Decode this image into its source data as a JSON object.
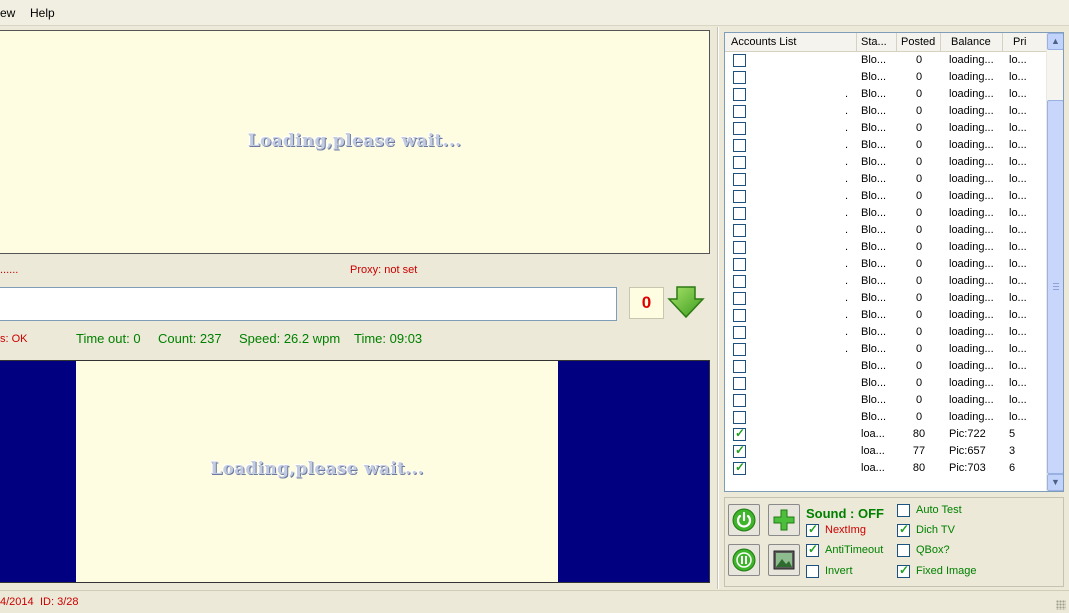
{
  "menu": {
    "items": [
      "ew",
      "Help"
    ]
  },
  "captcha_top": {
    "loading_text": "Loading,please wait..."
  },
  "status_line": {
    "left_text": "......",
    "proxy_text": "Proxy: not set"
  },
  "counter": {
    "value": "0"
  },
  "stats": {
    "status_text": "s: OK",
    "timeout": "Time out: 0",
    "count": "Count: 237",
    "speed": "Speed: 26.2 wpm",
    "time": "Time: 09:03"
  },
  "captcha_bottom": {
    "loading_text": "Loading,please wait..."
  },
  "statusbar": {
    "date_text": "4/2014",
    "id_text": "ID: 3/28"
  },
  "accounts": {
    "columns": [
      "Accounts List",
      "Sta...",
      "Posted",
      "Balance",
      "Pri"
    ],
    "rows": [
      {
        "checked": false,
        "dot": "",
        "status": "Blo...",
        "posted": "0",
        "balance": "loading...",
        "pri": "lo..."
      },
      {
        "checked": false,
        "dot": "",
        "status": "Blo...",
        "posted": "0",
        "balance": "loading...",
        "pri": "lo..."
      },
      {
        "checked": false,
        "dot": ".",
        "status": "Blo...",
        "posted": "0",
        "balance": "loading...",
        "pri": "lo..."
      },
      {
        "checked": false,
        "dot": ".",
        "status": "Blo...",
        "posted": "0",
        "balance": "loading...",
        "pri": "lo..."
      },
      {
        "checked": false,
        "dot": ".",
        "status": "Blo...",
        "posted": "0",
        "balance": "loading...",
        "pri": "lo..."
      },
      {
        "checked": false,
        "dot": ".",
        "status": "Blo...",
        "posted": "0",
        "balance": "loading...",
        "pri": "lo..."
      },
      {
        "checked": false,
        "dot": ".",
        "status": "Blo...",
        "posted": "0",
        "balance": "loading...",
        "pri": "lo..."
      },
      {
        "checked": false,
        "dot": ".",
        "status": "Blo...",
        "posted": "0",
        "balance": "loading...",
        "pri": "lo..."
      },
      {
        "checked": false,
        "dot": ".",
        "status": "Blo...",
        "posted": "0",
        "balance": "loading...",
        "pri": "lo..."
      },
      {
        "checked": false,
        "dot": ".",
        "status": "Blo...",
        "posted": "0",
        "balance": "loading...",
        "pri": "lo..."
      },
      {
        "checked": false,
        "dot": ".",
        "status": "Blo...",
        "posted": "0",
        "balance": "loading...",
        "pri": "lo..."
      },
      {
        "checked": false,
        "dot": ".",
        "status": "Blo...",
        "posted": "0",
        "balance": "loading...",
        "pri": "lo..."
      },
      {
        "checked": false,
        "dot": ".",
        "status": "Blo...",
        "posted": "0",
        "balance": "loading...",
        "pri": "lo..."
      },
      {
        "checked": false,
        "dot": ".",
        "status": "Blo...",
        "posted": "0",
        "balance": "loading...",
        "pri": "lo..."
      },
      {
        "checked": false,
        "dot": ".",
        "status": "Blo...",
        "posted": "0",
        "balance": "loading...",
        "pri": "lo..."
      },
      {
        "checked": false,
        "dot": ".",
        "status": "Blo...",
        "posted": "0",
        "balance": "loading...",
        "pri": "lo..."
      },
      {
        "checked": false,
        "dot": ".",
        "status": "Blo...",
        "posted": "0",
        "balance": "loading...",
        "pri": "lo..."
      },
      {
        "checked": false,
        "dot": ".",
        "status": "Blo...",
        "posted": "0",
        "balance": "loading...",
        "pri": "lo..."
      },
      {
        "checked": false,
        "dot": "",
        "status": "Blo...",
        "posted": "0",
        "balance": "loading...",
        "pri": "lo..."
      },
      {
        "checked": false,
        "dot": "",
        "status": "Blo...",
        "posted": "0",
        "balance": "loading...",
        "pri": "lo..."
      },
      {
        "checked": false,
        "dot": "",
        "status": "Blo...",
        "posted": "0",
        "balance": "loading...",
        "pri": "lo..."
      },
      {
        "checked": false,
        "dot": "",
        "status": "Blo...",
        "posted": "0",
        "balance": "loading...",
        "pri": "lo..."
      },
      {
        "checked": true,
        "dot": "",
        "status": "loa...",
        "posted": "80",
        "balance": "Pic:722",
        "pri": "5"
      },
      {
        "checked": true,
        "dot": "",
        "status": "loa...",
        "posted": "77",
        "balance": "Pic:657",
        "pri": "3"
      },
      {
        "checked": true,
        "dot": "",
        "status": "loa...",
        "posted": "80",
        "balance": "Pic:703",
        "pri": "6"
      }
    ]
  },
  "controls": {
    "sound_label": "Sound : OFF",
    "options": [
      {
        "key": "nextimg",
        "label": "NextImg",
        "checked": true,
        "color": "#cc0000"
      },
      {
        "key": "antitimeout",
        "label": "AntiTimeout",
        "checked": true,
        "color": "#008000"
      },
      {
        "key": "invert",
        "label": "Invert",
        "checked": false,
        "color": "#008000"
      },
      {
        "key": "autotest",
        "label": "Auto Test",
        "checked": false,
        "color": "#008000"
      },
      {
        "key": "dichtv",
        "label": "Dich TV",
        "checked": true,
        "color": "#008000"
      },
      {
        "key": "qbox",
        "label": "QBox?",
        "checked": false,
        "color": "#008000"
      },
      {
        "key": "fixedimage",
        "label": "Fixed Image",
        "checked": true,
        "color": "#008000"
      }
    ]
  },
  "colors": {
    "green_text": "#008000",
    "red_text": "#cc0000",
    "navy_bg": "#000080",
    "captcha_bg": "#fefde2"
  }
}
